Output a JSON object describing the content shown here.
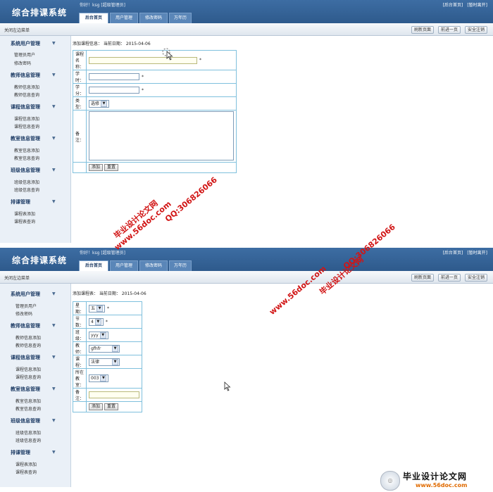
{
  "app": {
    "title": "综合排课系统",
    "greeting": "你好！ksg [超级管理员]",
    "top_links": [
      "[后台首页]",
      "[暂时离开]"
    ],
    "tabs": [
      "后台首页",
      "用户管理",
      "修改密码",
      "万年历"
    ],
    "close_menu": "关闭左边菜单",
    "toolbar_buttons": [
      "刷新页面",
      "前进一页",
      "安全注销"
    ]
  },
  "sidebar": {
    "groups": [
      {
        "title": "系统用户管理",
        "items": [
          "管理员用户",
          "修改密码"
        ]
      },
      {
        "title": "教师信息管理",
        "items": [
          "教师信息添加",
          "教师信息查询"
        ]
      },
      {
        "title": "课程信息管理",
        "items": [
          "课程信息添加",
          "课程信息查询"
        ]
      },
      {
        "title": "教室信息管理",
        "items": [
          "教室信息添加",
          "教室信息查询"
        ]
      },
      {
        "title": "班级信息管理",
        "items": [
          "班级信息添加",
          "班级信息查询"
        ]
      },
      {
        "title": "排课管理",
        "items": [
          "课程表添加",
          "课程表查询"
        ]
      }
    ],
    "chevron": "▼"
  },
  "form1": {
    "crumb": "添加课程信息：  当前日期： 2015-04-06",
    "fields": {
      "name": "课程名称：",
      "hours": "学时：",
      "credit": "学分：",
      "type": "类型：",
      "remark": "备注："
    },
    "type_value": "选修",
    "star": "*",
    "buttons": [
      "添加",
      "重置"
    ]
  },
  "form2": {
    "crumb": "添加课程表：  当前日期： 2015-04-06",
    "fields": {
      "weekday": "星期：",
      "period": "节数：",
      "class": "班级：",
      "teacher": "教师：",
      "course": "课程：",
      "room": "所在教室：",
      "remark": "备注："
    },
    "values": {
      "weekday": "五",
      "period": "4",
      "class": "yyy",
      "teacher": "gfhfr",
      "course": "法律",
      "room": "003"
    },
    "star": "*",
    "buttons": [
      "添加",
      "重置"
    ]
  },
  "watermark": {
    "site_name": "毕业设计论文网",
    "url": "www.56doc.com",
    "qq": "QQ:306826066",
    "brand_url": "www.56doc.com"
  },
  "icons": {
    "cursor": "cursor-arrow-icon",
    "loading": "loading-spinner-icon",
    "select_arrow": "chevron-down-icon"
  },
  "colors": {
    "header": "#2e5a8c",
    "sidebar": "#eaf0f7",
    "table_border": "#7fc0dd",
    "watermark": "#d11414"
  }
}
